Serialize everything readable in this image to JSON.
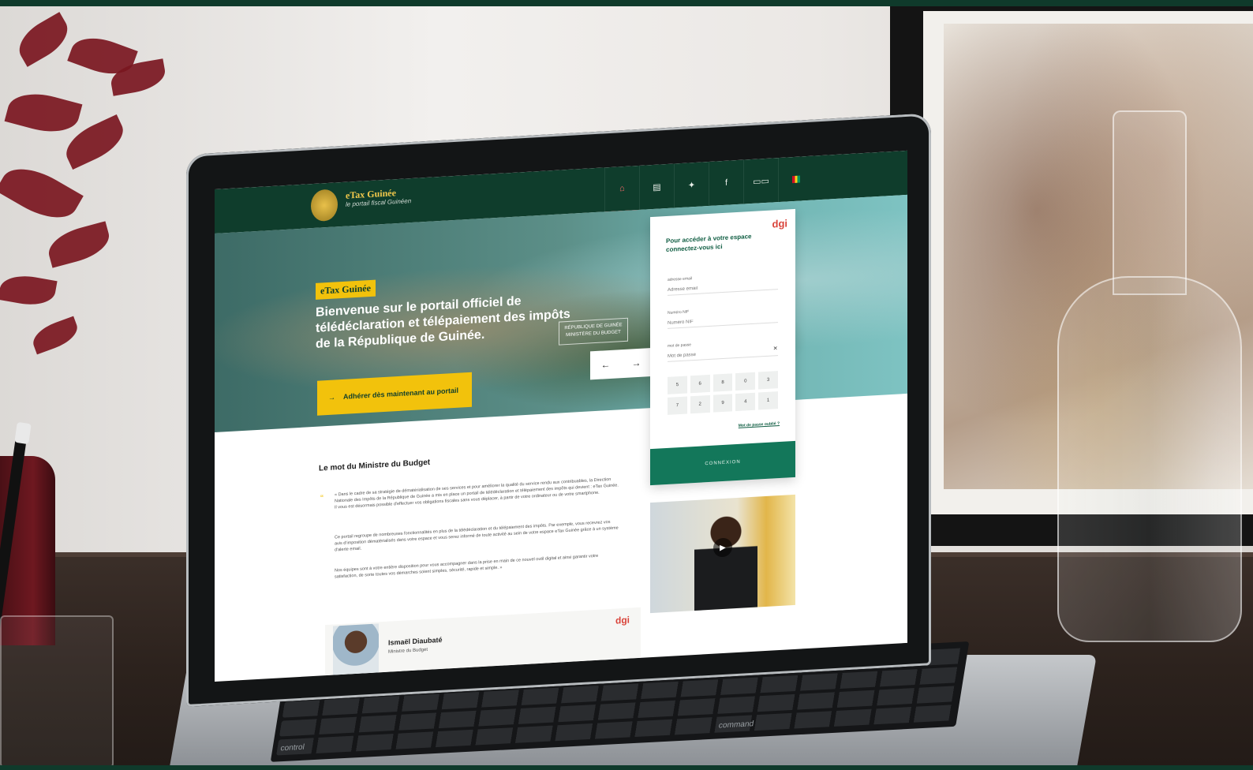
{
  "site": {
    "brand": "eTax Guinée",
    "tagline": "le portail fiscal Guinéen",
    "nav_icons": [
      "home-icon",
      "document-icon",
      "twitter-icon",
      "facebook-icon",
      "language-icon",
      "flag-icon"
    ]
  },
  "hero": {
    "badge": "eTax Guinée",
    "title": "Bienvenue sur le portail officiel de télédéclaration et télépaiement des impôts de la République de Guinée.",
    "ministry_logo": "RÉPUBLIQUE DE GUINÉE MINISTÈRE DU BUDGET",
    "cta_icon": "→",
    "cta": "Adhérer dès maintenant au portail",
    "prev_arrow": "←",
    "next_arrow": "→"
  },
  "login": {
    "title": "Pour accéder à votre espace connectez-vous ici",
    "dgi_logo": "dgi",
    "email_label": "adresse email",
    "email_placeholder": "Adresse email",
    "nif_label": "Numéro NIF",
    "nif_placeholder": "Numéro NIF",
    "password_label": "mot de passe",
    "password_placeholder": "Mot de passe",
    "clear": "×",
    "keypad": [
      "5",
      "6",
      "8",
      "0",
      "3",
      "7",
      "2",
      "9",
      "4",
      "1"
    ],
    "forgot": "Mot de passe oublié ?",
    "connect": "CONNEXION"
  },
  "minister": {
    "section_title": "Le mot du Ministre du Budget",
    "quote_mark": "“",
    "para1": "« Dans le cadre de sa stratégie de dématérialisation de ses services et pour améliorer la qualité du service rendu aux contribuables, la Direction Nationale des Impôts de la République de Guinée a mis en place un portail de télédéclaration et télépaiement des impôts qui devient : eTax Guinée. Il vous est désormais possible d'effectuer vos obligations fiscales sans vous déplacer, à partir de votre ordinateur ou de votre smartphone.",
    "para2": "Ce portail regroupe de nombreuses fonctionnalités en plus de la télédéclaration et du télépaiement des impôts. Par exemple, vous recevrez vos avis d'imposition dématérialisés dans votre espace et vous serez informé de toute activité au sein de votre espace eTax Guinée grâce à un système d'alerte email.",
    "para3": "Nos équipes sont à votre entière disposition pour vous accompagner dans la prise en main de ce nouvel outil digital et ainsi garantir votre satisfaction, de sorte toutes vos démarches soient simples, sécurité, rapide et simple. »",
    "name": "Ismaël Diaubaté",
    "role": "Ministre du Budget",
    "logos": "dgi"
  },
  "video": {
    "play_icon": "▶"
  },
  "keyboard": {
    "left_label": "control",
    "right_label": "command"
  }
}
